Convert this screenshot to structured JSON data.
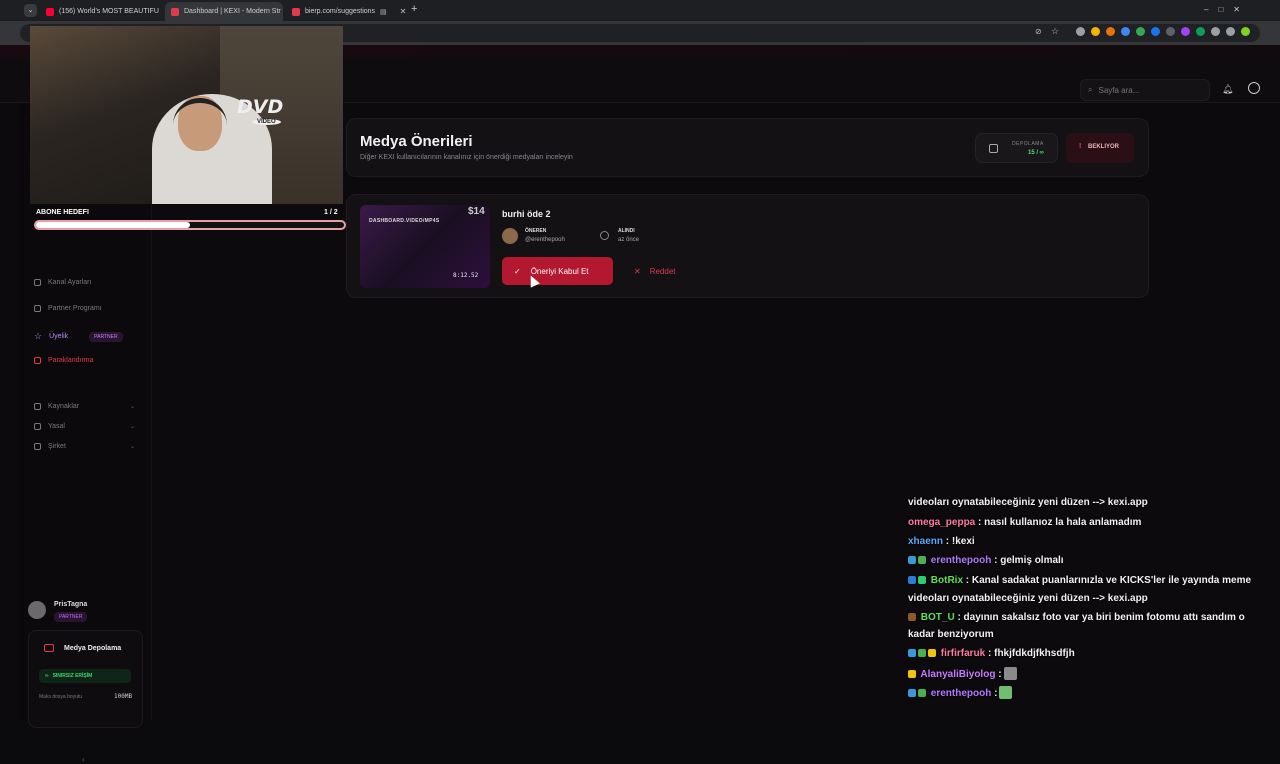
{
  "browser": {
    "tabs": [
      {
        "title": "(156) World's MOST BEAUTIFU",
        "active": false,
        "fav_color": "#ff0033"
      },
      {
        "title": "Dashboard | KEXI - Modern Str",
        "active": true,
        "fav_color": "#e23a4d"
      },
      {
        "title": "bierp.com/suggestions",
        "active": false,
        "fav_color": "#e23a4d"
      }
    ],
    "extension_colors": [
      "#9aa0a6",
      "#f4b400",
      "#e8710a",
      "#4285f4",
      "#34a853",
      "#1a73e8",
      "#5f6368",
      "#a142f4",
      "#0f9d58",
      "#9aa0a6",
      "#9aa0a6",
      "#7ed321"
    ]
  },
  "header": {
    "search_placeholder": "Sayfa ara..."
  },
  "sidebar": {
    "items": [
      {
        "label": "Kanal Ayarları"
      },
      {
        "label": "Partner Programı"
      },
      {
        "label": "Üyelik",
        "badge": "PARTNER"
      },
      {
        "label": "Paraklandırma"
      }
    ],
    "sections": [
      {
        "label": "Kaynaklar"
      },
      {
        "label": "Yasal"
      },
      {
        "label": "Şirket"
      }
    ],
    "user": {
      "name": "PrisTagna",
      "badge": "PARTNER"
    },
    "storage": {
      "title": "Medya Depolama",
      "access": "SINIRSIZ ERİŞİM",
      "max_label": "Maks dosya boyutu",
      "max_value": "100MB"
    }
  },
  "main": {
    "title": "Medya Önerileri",
    "subtitle": "Diğer KEXI kullanıcılarının kanalınız için önerdiği medyaları inceleyin",
    "storage_pill": {
      "label": "DEPOLAMA",
      "value": "15 / ∞"
    },
    "pending_pill": {
      "label": "BEKLIYOR",
      "icon": "!"
    },
    "suggestion": {
      "thumb_label": "DASHBOARD.VIDEO/MP4S",
      "thumb_number": "$14",
      "duration": "8:12.52",
      "title": "burhi öde 2",
      "suggester_label": "ÖNEREN",
      "suggester_name": "@erenthepooh",
      "received_label": "ALINDI",
      "received_value": "az önce",
      "accept_label": "Öneriyi Kabul Et",
      "reject_label": "Reddet"
    }
  },
  "overlay": {
    "sub_goal_label": "ABONE HEDEFI",
    "sub_goal_count": "1 / 2",
    "sub_goal_progress": 0.5,
    "dvd_text": "DVD",
    "dvd_sub": "VIDEO"
  },
  "chat": [
    {
      "user": "",
      "color": "#ffffff",
      "text": "videoları oynatabileceğiniz yeni düzen --> kexi.app"
    },
    {
      "user": "omega_peppa",
      "color": "#ff7aa0",
      "text": " : nasıl kullanıoz la hala anlamadım"
    },
    {
      "user": "xhaenn",
      "color": "#5aa9ff",
      "text": " : !kexi"
    },
    {
      "user": "erenthepooh",
      "color": "#b07aff",
      "text": " : gelmiş olmalı"
    },
    {
      "user": "BotRix",
      "color": "#5ee05a",
      "text": " : Kanal sadakat puanlarınızla ve KICKS'ler ile yayında meme"
    },
    {
      "user": "",
      "color": "#ffffff",
      "text": "videoları oynatabileceğiniz yeni düzen --> kexi.app"
    },
    {
      "user": "BOT_U",
      "color": "#5ee05a",
      "text": " : dayının sakalsız foto var ya biri benim fotomu attı sandım o"
    },
    {
      "user": "",
      "color": "#ffffff",
      "text": "kadar benziyorum"
    },
    {
      "user": "firfirfaruk",
      "color": "#ff7aa0",
      "text": " : fhkjfdkdjfkhsdfjh"
    },
    {
      "user": "AlanyaliBiyolog",
      "color": "#c77dff",
      "text": " :"
    },
    {
      "user": "erenthepooh",
      "color": "#b07aff",
      "text": " :"
    }
  ]
}
